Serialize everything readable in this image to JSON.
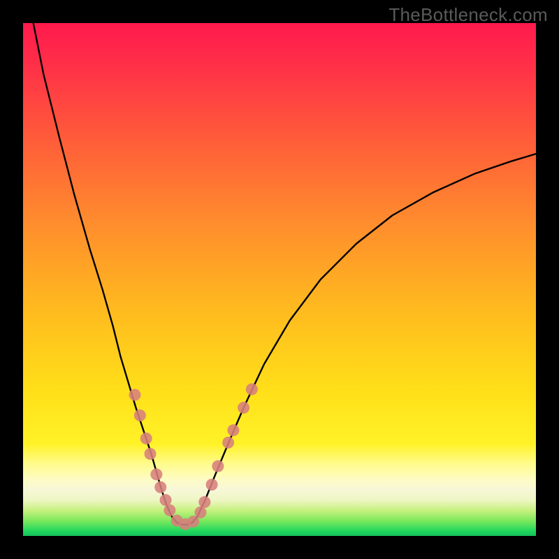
{
  "watermark": "TheBottleneck.com",
  "chart_data": {
    "type": "line",
    "title": "",
    "xlabel": "",
    "ylabel": "",
    "xlim": [
      0,
      100
    ],
    "ylim": [
      0,
      100
    ],
    "series": [
      {
        "name": "left-curve",
        "x": [
          2,
          4,
          7,
          10,
          13,
          15.5,
          17.5,
          19,
          20.5,
          22,
          23.5,
          25,
          26,
          27,
          28,
          29
        ],
        "y": [
          100,
          90,
          78,
          66.5,
          56,
          48,
          41,
          35,
          30,
          25,
          20.5,
          16,
          12.5,
          9,
          6,
          3.8
        ]
      },
      {
        "name": "valley-floor",
        "x": [
          29,
          30,
          31,
          32,
          33,
          34
        ],
        "y": [
          3.8,
          2.6,
          2.2,
          2.2,
          2.6,
          3.8
        ]
      },
      {
        "name": "right-curve",
        "x": [
          34,
          35.5,
          37.5,
          40,
          43,
          47,
          52,
          58,
          65,
          72,
          80,
          88,
          95,
          100
        ],
        "y": [
          3.8,
          7,
          12,
          18,
          25,
          33.5,
          42,
          50,
          57,
          62.5,
          67,
          70.6,
          73,
          74.5
        ]
      }
    ],
    "markers": {
      "name": "highlight-dots",
      "points": [
        {
          "x": 21.8,
          "y": 27.5
        },
        {
          "x": 22.8,
          "y": 23.5
        },
        {
          "x": 24.0,
          "y": 19.0
        },
        {
          "x": 24.8,
          "y": 16.0
        },
        {
          "x": 26.0,
          "y": 12.0
        },
        {
          "x": 26.8,
          "y": 9.5
        },
        {
          "x": 27.8,
          "y": 7.0
        },
        {
          "x": 28.6,
          "y": 5.0
        },
        {
          "x": 30.0,
          "y": 3.0
        },
        {
          "x": 31.6,
          "y": 2.3
        },
        {
          "x": 33.2,
          "y": 2.8
        },
        {
          "x": 34.6,
          "y": 4.6
        },
        {
          "x": 35.4,
          "y": 6.6
        },
        {
          "x": 36.8,
          "y": 10.0
        },
        {
          "x": 38.0,
          "y": 13.6
        },
        {
          "x": 40.0,
          "y": 18.2
        },
        {
          "x": 41.0,
          "y": 20.6
        },
        {
          "x": 43.0,
          "y": 25.0
        },
        {
          "x": 44.6,
          "y": 28.6
        }
      ]
    },
    "gradient_stops": [
      {
        "pos": 0.0,
        "color": "#ff1a4d"
      },
      {
        "pos": 0.38,
        "color": "#ff8a2e"
      },
      {
        "pos": 0.72,
        "color": "#ffe019"
      },
      {
        "pos": 0.9,
        "color": "#f7f7d8"
      },
      {
        "pos": 1.0,
        "color": "#14c05a"
      }
    ]
  }
}
